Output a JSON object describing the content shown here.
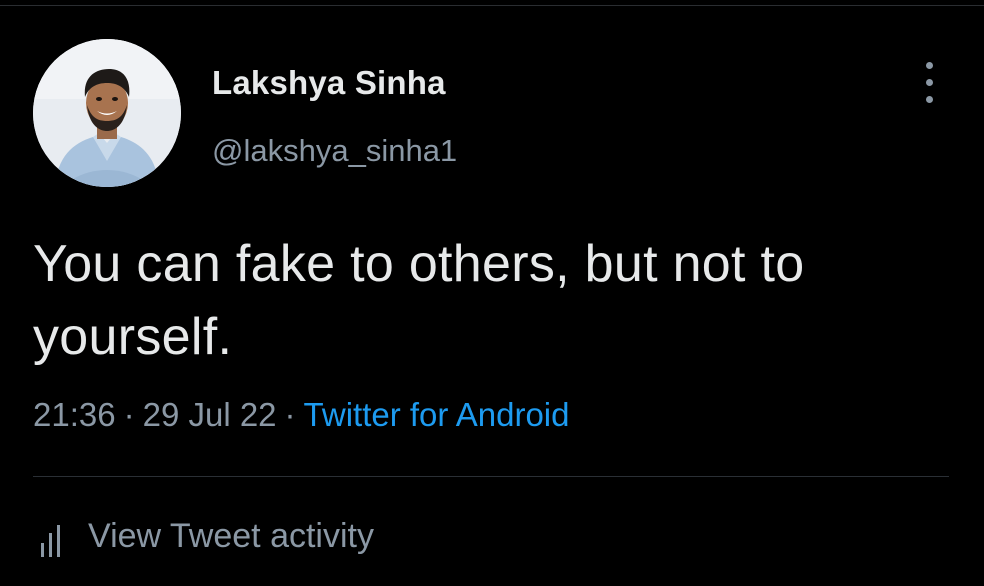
{
  "tweet": {
    "author": {
      "display_name": "Lakshya Sinha",
      "handle": "@lakshya_sinha1",
      "avatar_icon": "profile-photo"
    },
    "text": "You can fake to others, but not to yourself.",
    "time": "21:36",
    "date": "29 Jul 22",
    "separator": "·",
    "source": "Twitter for Android",
    "more_icon": "vertical-ellipsis-icon",
    "activity": {
      "icon": "bar-chart-icon",
      "label": "View Tweet activity"
    }
  },
  "colors": {
    "background": "#000000",
    "primary_text": "#e7e9ea",
    "secondary_text": "#8b98a5",
    "link": "#1d9bf0",
    "divider": "#2a2f35"
  }
}
